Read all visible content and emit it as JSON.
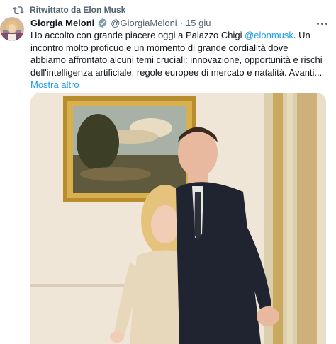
{
  "retweet": {
    "label": "Ritwittato da Elon Musk",
    "icon": "retweet-icon"
  },
  "author": {
    "name": "Giorgia Meloni",
    "handle": "@GiorgiaMeloni",
    "separator": "·",
    "date": "15 giu",
    "verified_icon": "verified-badge-icon",
    "avatar_icon": "avatar"
  },
  "tweet": {
    "text_before": "Ho accolto con grande piacere oggi a Palazzo Chigi ",
    "mention": "@elonmusk",
    "text_after": ". Un incontro molto proficuo e un momento di grande cordialità dove abbiamo affrontato alcuni temi cruciali: innovazione, opportunità e rischi dell'intelligenza artificiale, regole europee di mercato e natalità. Avanti...",
    "show_more": "Mostra altro"
  },
  "colors": {
    "accent": "#1d9bf0",
    "secondary_text": "#536471",
    "primary_text": "#0f1419"
  }
}
